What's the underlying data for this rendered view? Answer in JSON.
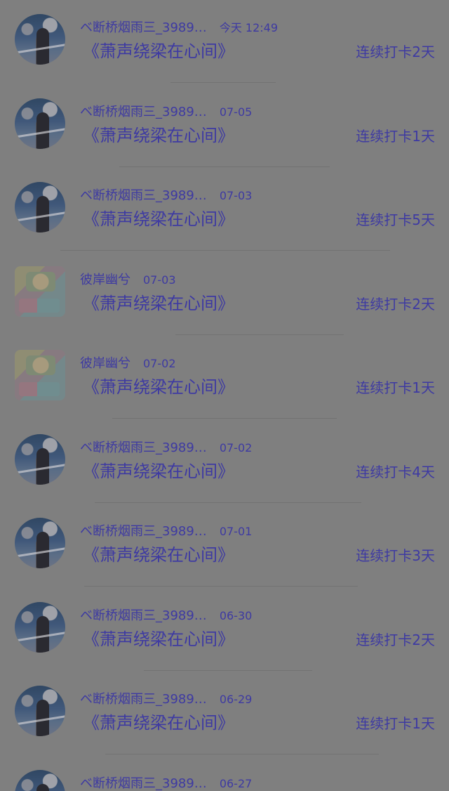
{
  "items": [
    {
      "user_name": "ベ断桥烟雨三_3989…",
      "time": "今天 12:49",
      "title": "《萧声绕梁在心间》",
      "streak": "连续打卡2天",
      "avatar": "sky-silhouette"
    },
    {
      "user_name": "ベ断桥烟雨三_3989…",
      "time": "07-05",
      "title": "《萧声绕梁在心间》",
      "streak": "连续打卡1天",
      "avatar": "sky-silhouette"
    },
    {
      "user_name": "ベ断桥烟雨三_3989…",
      "time": "07-03",
      "title": "《萧声绕梁在心间》",
      "streak": "连续打卡5天",
      "avatar": "sky-silhouette"
    },
    {
      "user_name": "彼岸幽兮",
      "time": "07-03",
      "title": "《萧声绕梁在心间》",
      "streak": "连续打卡2天",
      "avatar": "anime-collage"
    },
    {
      "user_name": "彼岸幽兮",
      "time": "07-02",
      "title": "《萧声绕梁在心间》",
      "streak": "连续打卡1天",
      "avatar": "anime-collage"
    },
    {
      "user_name": "ベ断桥烟雨三_3989…",
      "time": "07-02",
      "title": "《萧声绕梁在心间》",
      "streak": "连续打卡4天",
      "avatar": "sky-silhouette"
    },
    {
      "user_name": "ベ断桥烟雨三_3989…",
      "time": "07-01",
      "title": "《萧声绕梁在心间》",
      "streak": "连续打卡3天",
      "avatar": "sky-silhouette"
    },
    {
      "user_name": "ベ断桥烟雨三_3989…",
      "time": "06-30",
      "title": "《萧声绕梁在心间》",
      "streak": "连续打卡2天",
      "avatar": "sky-silhouette"
    },
    {
      "user_name": "ベ断桥烟雨三_3989…",
      "time": "06-29",
      "title": "《萧声绕梁在心间》",
      "streak": "连续打卡1天",
      "avatar": "sky-silhouette"
    },
    {
      "user_name": "ベ断桥烟雨三_3989…",
      "time": "06-27",
      "title": "",
      "streak": "",
      "avatar": "sky-silhouette"
    }
  ],
  "colors": {
    "background": "#7f7f7f",
    "text": "#3e3aa2",
    "divider": "#5c5c5c"
  }
}
